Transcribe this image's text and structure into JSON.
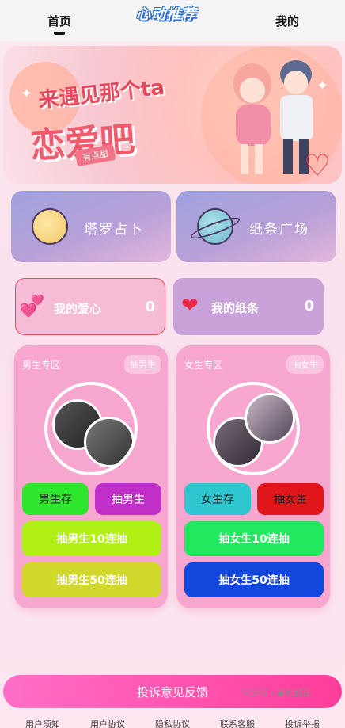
{
  "topnav": {
    "home": "首页",
    "mine": "我的",
    "logo": "心动推荐"
  },
  "banner": {
    "line1": "来遇见那个ta",
    "line2": "恋爱吧",
    "tag": "有点甜"
  },
  "features": [
    {
      "label": "塔罗占卜",
      "icon": "moon-icon"
    },
    {
      "label": "纸条广场",
      "icon": "planet-icon"
    }
  ],
  "mini_cards": [
    {
      "label": "我的爱心",
      "count": "0",
      "icon": "love-heart-icon",
      "badge": "爱心"
    },
    {
      "label": "我的纸条",
      "count": "0",
      "icon": "heart-note-icon"
    }
  ],
  "zones": [
    {
      "title": "男生专区",
      "draw": "抽男生",
      "store": "男生存",
      "pick": "抽男生",
      "pick10": "抽男生10连抽",
      "pick50": "抽男生50连抽",
      "colors": {
        "store": "#2ee62e",
        "pick": "#c12fc9",
        "pick10": "#b1f014",
        "pick50": "#d2d72b"
      }
    },
    {
      "title": "女生专区",
      "draw": "抽女生",
      "store": "女生存",
      "pick": "抽女生",
      "pick10": "抽女生10连抽",
      "pick50": "抽女生50连抽",
      "colors": {
        "store": "#2ec7cf",
        "pick": "#e0161a",
        "pick10": "#22e860",
        "pick50": "#1346dc"
      }
    }
  ],
  "feedback": "投诉意见反馈",
  "footer": [
    "用户须知",
    "用户协议",
    "隐私协议",
    "联系客服",
    "投诉举报"
  ],
  "watermark": "公众号 · 季风科技"
}
